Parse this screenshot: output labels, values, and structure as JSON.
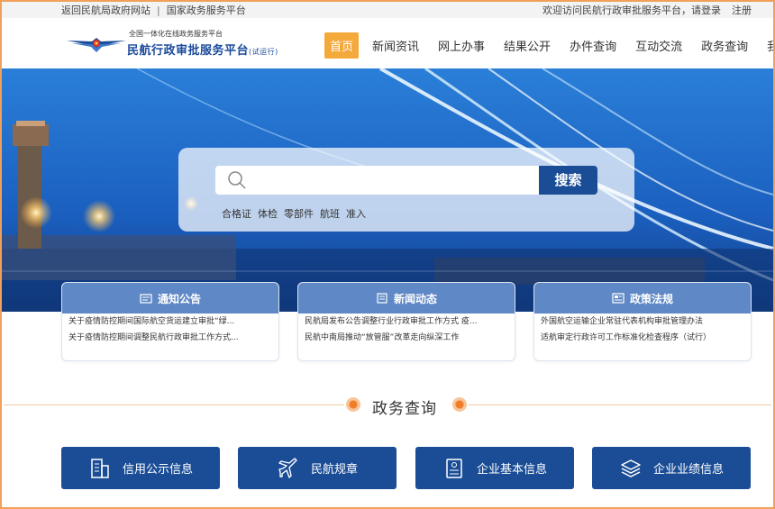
{
  "topbar": {
    "link_gov": "返回民航局政府网站",
    "separator": "|",
    "link_national": "国家政务服务平台",
    "welcome": "欢迎访问民航行政审批服务平台，请登录",
    "register": "注册"
  },
  "brand": {
    "subtitle": "全国一体化在线政务服务平台",
    "title": "民航行政审批服务平台",
    "trial": "(试运行)"
  },
  "nav": {
    "items": [
      "首页",
      "新闻资讯",
      "网上办事",
      "结果公开",
      "办件查询",
      "互动交流",
      "政务查询",
      "我的"
    ],
    "active_index": 0
  },
  "search": {
    "placeholder": "",
    "button": "搜索",
    "hot_words": [
      "合格证",
      "体检",
      "零部件",
      "航班",
      "准入"
    ]
  },
  "cards": [
    {
      "title": "通知公告",
      "icon": "notice-icon",
      "items": [
        "关于疫情防控期间国际航空货运建立审批“绿...",
        "关于疫情防控期间调整民航行政审批工作方式..."
      ]
    },
    {
      "title": "新闻动态",
      "icon": "news-icon",
      "items": [
        "民航局发布公告调整行业行政审批工作方式 疫...",
        "民航中南局推动“放管服”改革走向纵深工作"
      ]
    },
    {
      "title": "政策法规",
      "icon": "policy-icon",
      "items": [
        "外国航空运输企业常驻代表机构审批管理办法",
        "适航审定行政许可工作标准化检查程序（试行）"
      ]
    }
  ],
  "section": {
    "title": "政务查询"
  },
  "queries": [
    {
      "label": "信用公示信息",
      "icon": "credit-building-icon"
    },
    {
      "label": "民航规章",
      "icon": "airplane-icon"
    },
    {
      "label": "企业基本信息",
      "icon": "id-card-icon"
    },
    {
      "label": "企业业绩信息",
      "icon": "layers-icon"
    }
  ],
  "colors": {
    "primary": "#1a4d96",
    "accent": "#f4a93b",
    "card_header": "#5f88c6",
    "border": "#f0a05a"
  }
}
